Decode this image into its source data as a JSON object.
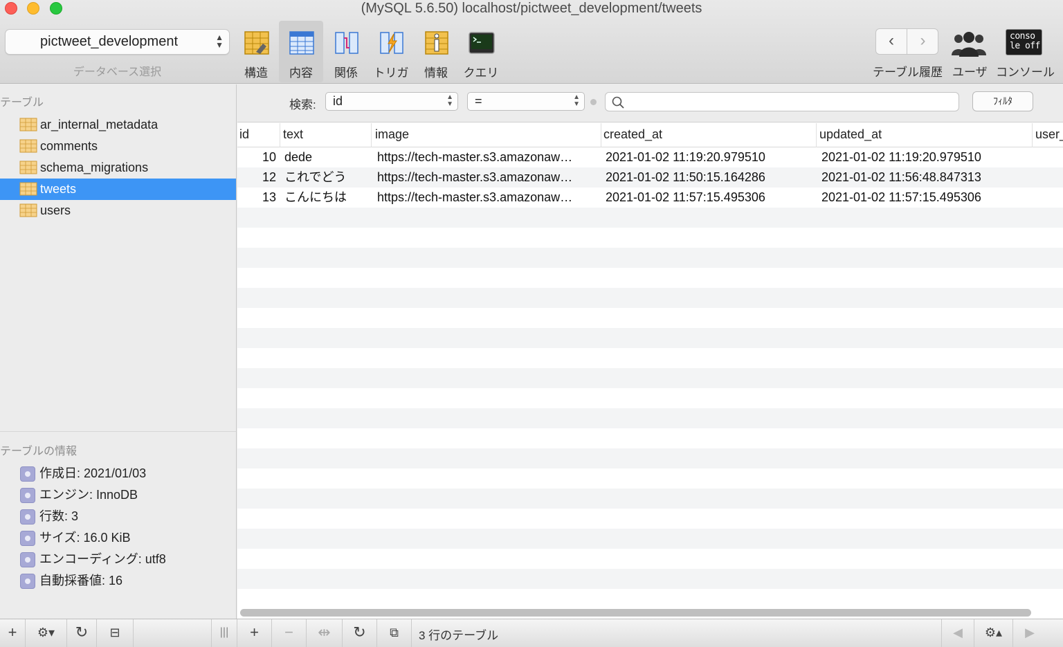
{
  "window": {
    "title": "(MySQL 5.6.50) localhost/pictweet_development/tweets"
  },
  "toolbar": {
    "database_select": {
      "value": "pictweet_development",
      "caption": "データベース選択"
    },
    "buttons": [
      {
        "id": "structure",
        "label": "構造",
        "icon": "structure-icon"
      },
      {
        "id": "content",
        "label": "内容",
        "icon": "content-icon",
        "active": true
      },
      {
        "id": "relations",
        "label": "関係",
        "icon": "relations-icon"
      },
      {
        "id": "triggers",
        "label": "トリガ",
        "icon": "triggers-icon"
      },
      {
        "id": "info",
        "label": "情報",
        "icon": "info-icon"
      },
      {
        "id": "query",
        "label": "クエリ",
        "icon": "query-icon"
      }
    ],
    "history_label": "テーブル履歴",
    "users_label": "ユーザ",
    "console_label": "コンソール",
    "console_icon_text": "conso le off"
  },
  "sidebar": {
    "tables_header": "テーブル",
    "tables": [
      {
        "name": "ar_internal_metadata"
      },
      {
        "name": "comments"
      },
      {
        "name": "schema_migrations"
      },
      {
        "name": "tweets",
        "selected": true
      },
      {
        "name": "users"
      }
    ],
    "info_header": "テーブルの情報",
    "info": [
      "作成日: 2021/01/03",
      "エンジン: InnoDB",
      "行数: 3",
      "サイズ: 16.0 KiB",
      "エンコーディング: utf8",
      "自動採番値: 16"
    ]
  },
  "filter": {
    "label": "検索:",
    "field": "id",
    "operator": "=",
    "search_value": "",
    "button_label": "ﾌｨﾙﾀ"
  },
  "grid": {
    "columns": [
      "id",
      "text",
      "image",
      "created_at",
      "updated_at",
      "user_"
    ],
    "rows": [
      {
        "id": "10",
        "text": "dede",
        "image": "https://tech-master.s3.amazonaw…",
        "created_at": "2021-01-02 11:19:20.979510",
        "updated_at": "2021-01-02 11:19:20.979510"
      },
      {
        "id": "12",
        "text": "これでどう",
        "image": "https://tech-master.s3.amazonaw…",
        "created_at": "2021-01-02 11:50:15.164286",
        "updated_at": "2021-01-02 11:56:48.847313"
      },
      {
        "id": "13",
        "text": "こんにちは",
        "image": "https://tech-master.s3.amazonaw…",
        "created_at": "2021-01-02 11:57:15.495306",
        "updated_at": "2021-01-02 11:57:15.495306"
      }
    ]
  },
  "statusbar": {
    "text": "3 行のテーブル"
  },
  "colors": {
    "selection": "#3d95f5",
    "stripe": "#f3f4f5"
  }
}
